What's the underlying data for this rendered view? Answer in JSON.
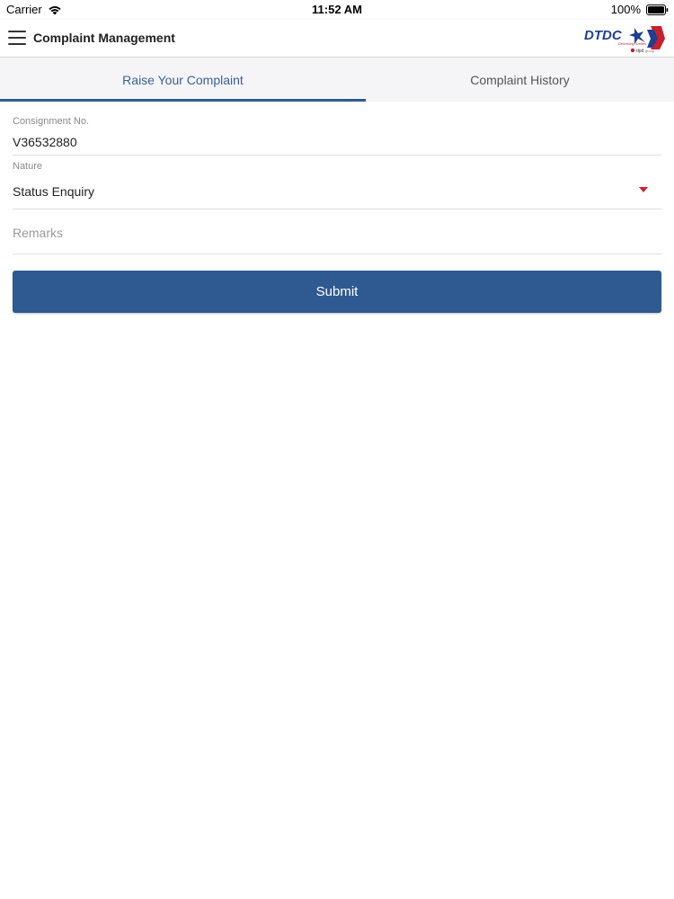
{
  "status_bar": {
    "carrier": "Carrier",
    "time": "11:52 AM",
    "battery": "100%"
  },
  "header": {
    "title": "Complaint Management",
    "logo_text": "DTDC",
    "logo_tagline": "Delivering Smiles",
    "logo_partner": "dpdgroup"
  },
  "tabs": [
    {
      "label": "Raise Your Complaint",
      "active": true
    },
    {
      "label": "Complaint History",
      "active": false
    }
  ],
  "form": {
    "consignment": {
      "label": "Consignment No.",
      "value": "V36532880"
    },
    "nature": {
      "label": "Nature",
      "value": "Status Enquiry"
    },
    "remarks": {
      "placeholder": "Remarks",
      "value": ""
    },
    "submit_label": "Submit"
  },
  "colors": {
    "primary": "#2e5a91",
    "active_tab_text": "#3a6296",
    "caret": "#d0202e",
    "tab_bg": "#f5f5f7"
  }
}
